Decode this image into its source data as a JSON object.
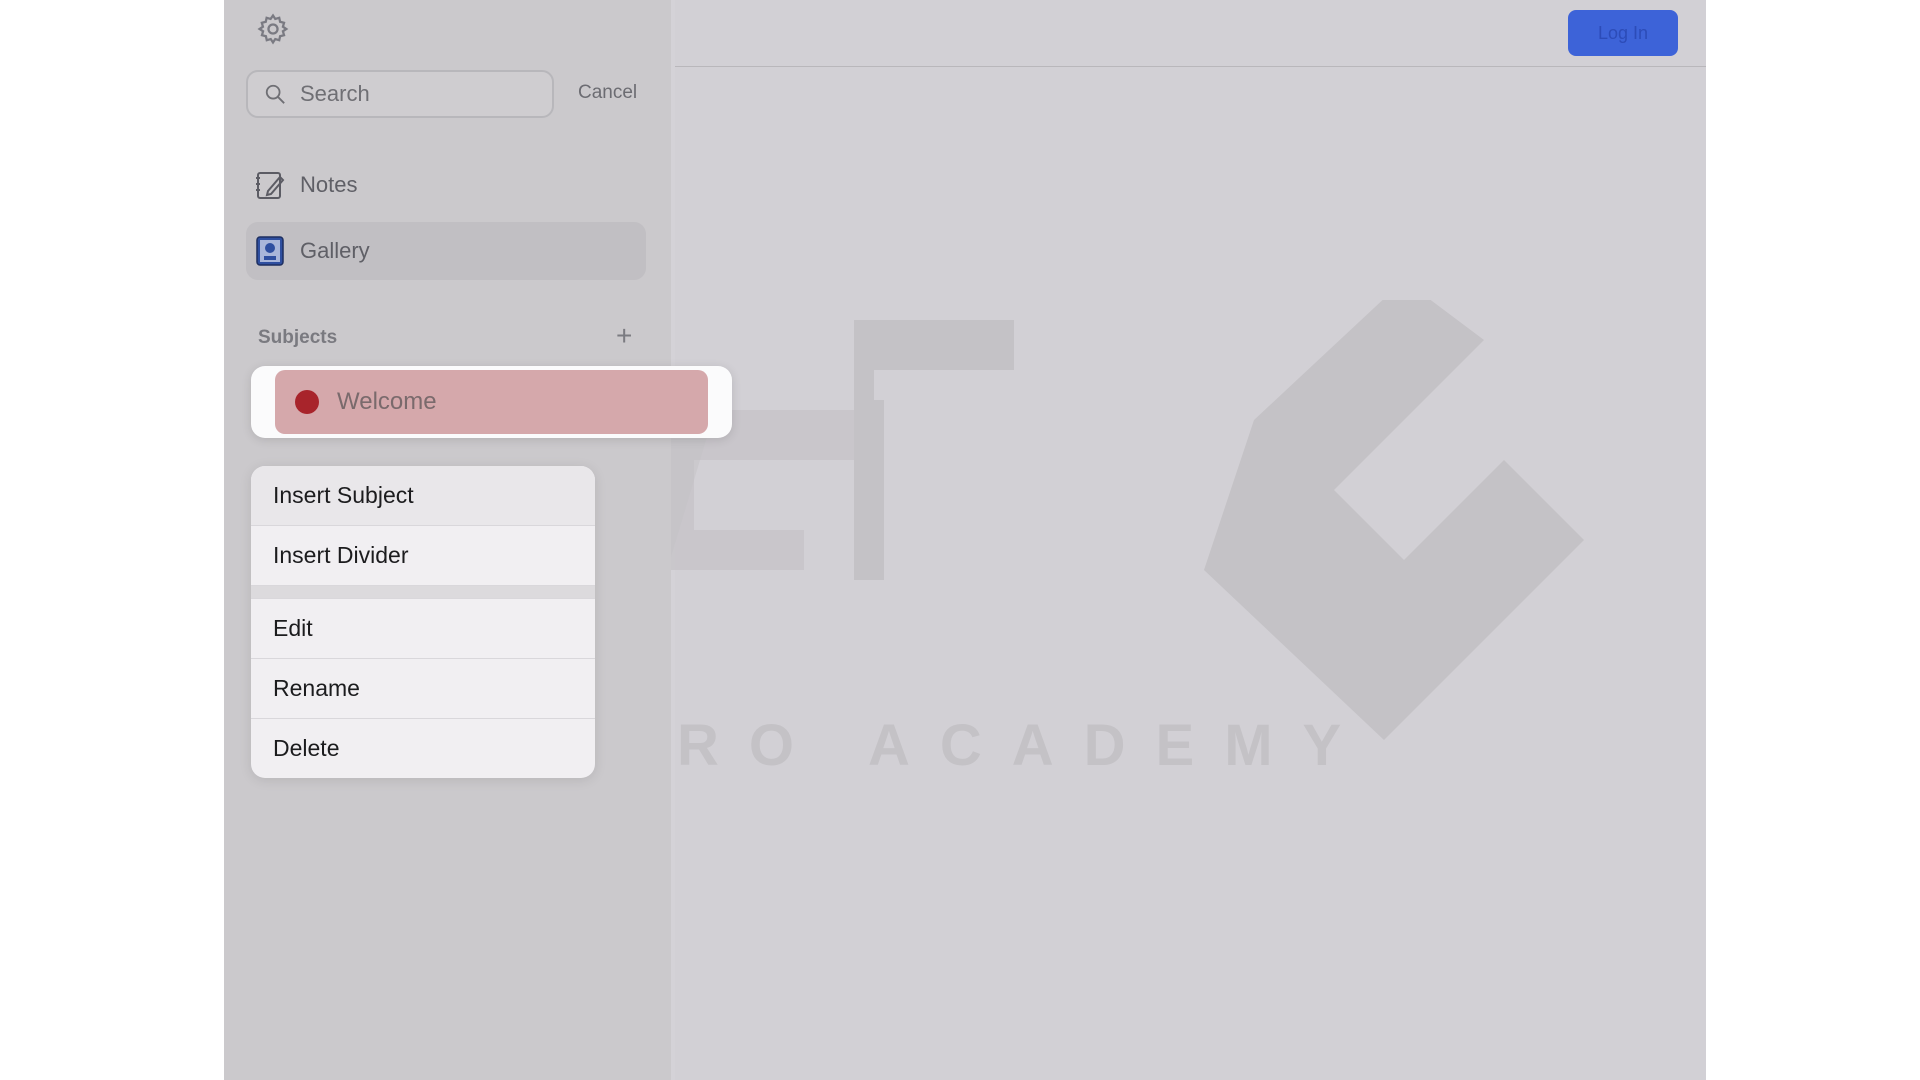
{
  "header": {
    "login_label": "Log In"
  },
  "search": {
    "placeholder": "Search",
    "cancel_label": "Cancel"
  },
  "sidebar": {
    "items": [
      {
        "label": "Notes",
        "icon": "notes-icon"
      },
      {
        "label": "Gallery",
        "icon": "gallery-icon",
        "selected": true
      }
    ],
    "subjects_title": "Subjects",
    "add_subject_glyph": "+"
  },
  "subject": {
    "label": "Welcome",
    "color": "#a8242b"
  },
  "context_menu": {
    "items": [
      "Insert Subject",
      "Insert Divider",
      "Edit",
      "Rename",
      "Delete"
    ]
  },
  "watermark": {
    "text": "ATRO ACADEMY"
  },
  "colors": {
    "accent": "#3d63d8",
    "subject_highlight": "#d5a8ab"
  }
}
